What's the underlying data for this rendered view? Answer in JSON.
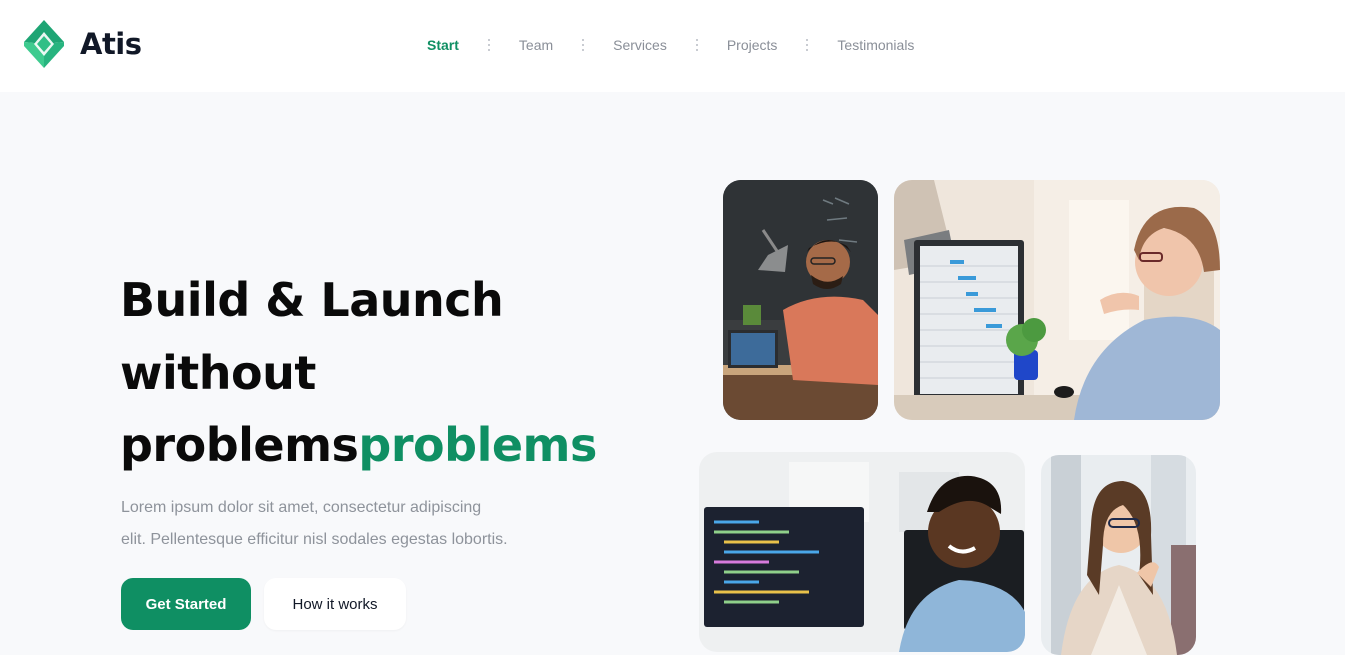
{
  "brand": {
    "name": "Atis",
    "logo_icon": "diamond-logo-icon",
    "accent": "#0f8f63",
    "accent_light": "#3ecb8f"
  },
  "nav": {
    "items": [
      {
        "label": "Start",
        "active": true
      },
      {
        "label": "Team",
        "active": false
      },
      {
        "label": "Services",
        "active": false
      },
      {
        "label": "Projects",
        "active": false
      },
      {
        "label": "Testimonials",
        "active": false
      }
    ]
  },
  "hero": {
    "headline_line1": "Build & Launch",
    "headline_line2": "without",
    "headline_line3_dark": "problems",
    "headline_line3_green": "problems",
    "description_line1": "Lorem ipsum dolor sit amet, consectetur adipiscing",
    "description_line2": "elit. Pellentesque efficitur nisl sodales egestas lobortis.",
    "primary_button": "Get Started",
    "secondary_button": "How it works"
  },
  "colors": {
    "background": "#f8f9fb",
    "header": "#ffffff",
    "text": "#0a0a0a",
    "muted": "#8e939b"
  }
}
